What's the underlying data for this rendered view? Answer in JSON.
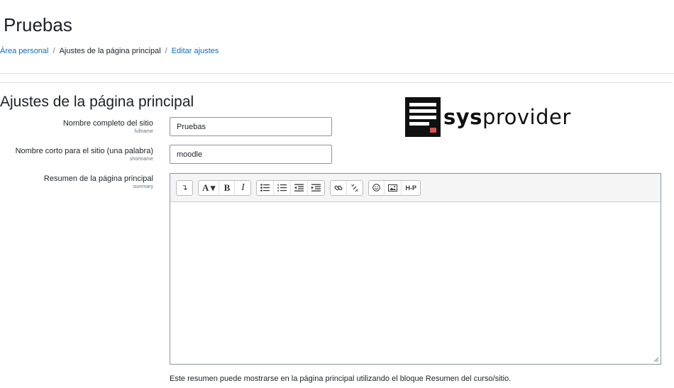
{
  "page": {
    "title": "Pruebas"
  },
  "breadcrumb": [
    {
      "label": "Área personal"
    },
    {
      "label": "Ajustes de la página principal"
    },
    {
      "label": "Editar ajustes"
    }
  ],
  "section": {
    "title": "Ajustes de la página principal"
  },
  "logo": {
    "text_bold": "sys",
    "text_regular": "provider",
    "accent_color": "#d9534f"
  },
  "form": {
    "fullname": {
      "label": "Nombre completo del sitio",
      "sublabel": "fullname",
      "value": "Pruebas"
    },
    "shortname": {
      "label": "Nombre corto para el sitio (una palabra)",
      "sublabel": "shortname",
      "value": "moodle"
    },
    "summary": {
      "label": "Resumen de la página principal",
      "sublabel": "summary",
      "help": "Este resumen puede mostrarse en la página principal utilizando el bloque Resumen del curso/sitio."
    }
  },
  "toolbar": {
    "collapse": "↴",
    "font": "A ▾",
    "bold": "B",
    "italic": "I",
    "h5p": "H-P"
  },
  "colors": {
    "link": "#0f6cbf",
    "border": "#8f959e"
  }
}
